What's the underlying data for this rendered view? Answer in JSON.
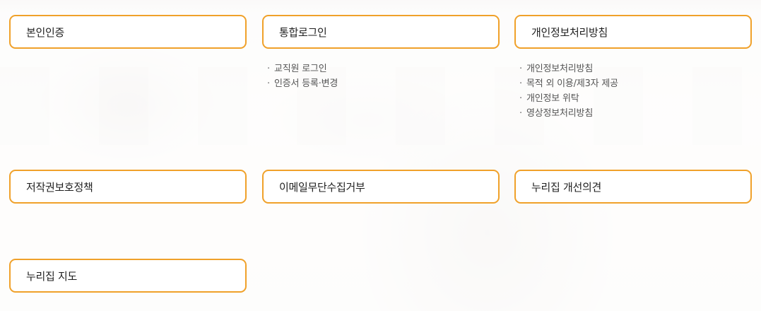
{
  "menus": {
    "identity_verification": {
      "label": "본인인증"
    },
    "integrated_login": {
      "label": "통합로그인",
      "items": [
        {
          "label": "교직원 로그인"
        },
        {
          "label": "인증서 등록·변경"
        }
      ]
    },
    "privacy_policy": {
      "label": "개인정보처리방침",
      "items": [
        {
          "label": "개인정보처리방침"
        },
        {
          "label": "목적 외 이용/제3자 제공"
        },
        {
          "label": "개인정보 위탁"
        },
        {
          "label": "영상정보처리방침"
        }
      ]
    },
    "copyright_policy": {
      "label": "저작권보호정책"
    },
    "email_refusal": {
      "label": "이메일무단수집거부"
    },
    "nurijip_feedback": {
      "label": "누리집 개선의견"
    },
    "nurijip_sitemap": {
      "label": "누리집 지도"
    }
  },
  "bullet": "·",
  "colors": {
    "accent_border": "#f0a12a",
    "text": "#1f1f1f",
    "sub_text": "#555555"
  }
}
